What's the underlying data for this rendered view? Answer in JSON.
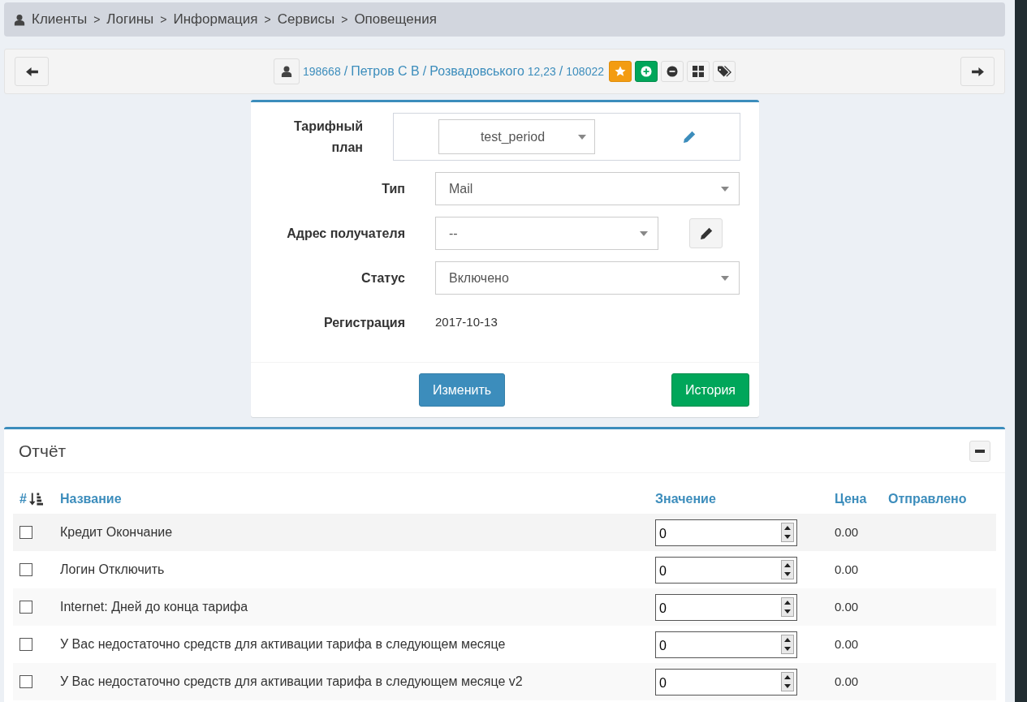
{
  "breadcrumb": [
    "Клиенты",
    "Логины",
    "Информация",
    "Сервисы",
    "Оповещения"
  ],
  "breadcrumb_separator": ">",
  "client_bar": {
    "parts": [
      {
        "kind": "link-small",
        "text": "198668"
      },
      {
        "kind": "sep",
        "text": "/"
      },
      {
        "kind": "link-large",
        "text": "Петров С В"
      },
      {
        "kind": "sep",
        "text": "/"
      },
      {
        "kind": "link-large",
        "text": "Розвадовського"
      },
      {
        "kind": "link-small",
        "text": "12,23"
      },
      {
        "kind": "sep",
        "text": "/"
      },
      {
        "kind": "link-small",
        "text": "108022"
      }
    ]
  },
  "form": {
    "fields": [
      {
        "kind": "plan",
        "label": "Тарифный план",
        "value": "test_period"
      },
      {
        "kind": "select",
        "label": "Тип",
        "value": "Mail"
      },
      {
        "kind": "select-edit",
        "label": "Адрес получателя",
        "value": "--"
      },
      {
        "kind": "select",
        "label": "Статус",
        "value": "Включено"
      },
      {
        "kind": "text",
        "label": "Регистрация",
        "value": "2017-10-13"
      }
    ],
    "buttons": [
      {
        "label": "Изменить"
      },
      {
        "label": "История"
      }
    ]
  },
  "report": {
    "title": "Отчёт",
    "columns": [
      "#",
      "Название",
      "Значение",
      "Цена",
      "Отправлено"
    ],
    "rows": [
      {
        "checked": false,
        "name": "Кредит Окончание",
        "value": "0",
        "price": "0.00"
      },
      {
        "checked": false,
        "name": "Логин Отключить",
        "value": "0",
        "price": "0.00"
      },
      {
        "checked": false,
        "name": "Internet: Дней до конца тарифа",
        "value": "0",
        "price": "0.00"
      },
      {
        "checked": false,
        "name": "У Вас недостаточно средств для активации тарифа в следующем месяце",
        "value": "0",
        "price": "0.00"
      },
      {
        "checked": false,
        "name": "У Вас недостаточно средств для активации тарифа в следующем месяце v2",
        "value": "0",
        "price": "0.00"
      }
    ]
  }
}
